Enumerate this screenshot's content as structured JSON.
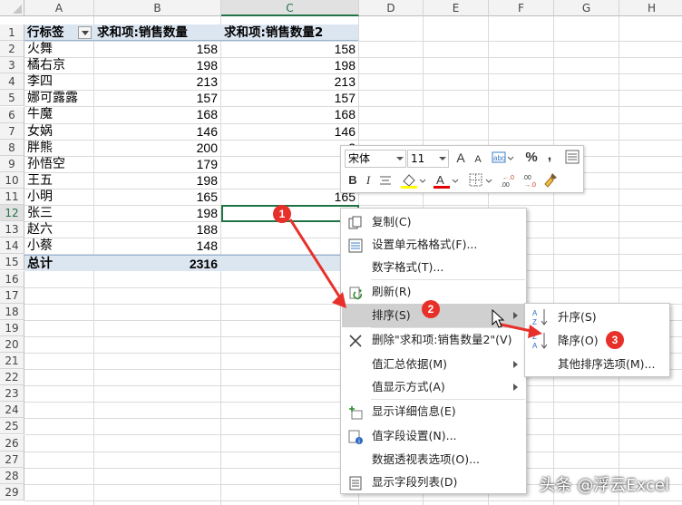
{
  "columns": [
    "A",
    "B",
    "C",
    "D",
    "E",
    "F",
    "G",
    "H"
  ],
  "selected_column": "C",
  "row_numbers": [
    "1",
    "2",
    "3",
    "4",
    "5",
    "6",
    "7",
    "8",
    "9",
    "10",
    "11",
    "12",
    "13",
    "14",
    "15",
    "16",
    "17",
    "18",
    "19",
    "20",
    "21",
    "22",
    "23",
    "24",
    "25",
    "26",
    "27",
    "28",
    "29"
  ],
  "selected_row": "12",
  "pivot": {
    "header": {
      "a": "行标签",
      "b": "求和项:销售数量",
      "c": "求和项:销售数量2"
    },
    "rows": [
      {
        "a": "火舞",
        "b": "158",
        "c": "158"
      },
      {
        "a": "橘右京",
        "b": "198",
        "c": "198"
      },
      {
        "a": "李四",
        "b": "213",
        "c": "213"
      },
      {
        "a": "娜可露露",
        "b": "157",
        "c": "157"
      },
      {
        "a": "牛魔",
        "b": "168",
        "c": "168"
      },
      {
        "a": "女娲",
        "b": "146",
        "c": "146"
      },
      {
        "a": "胖熊",
        "b": "200",
        "c": "2"
      },
      {
        "a": "孙悟空",
        "b": "179",
        "c": "1"
      },
      {
        "a": "王五",
        "b": "198",
        "c": "1"
      },
      {
        "a": "小明",
        "b": "165",
        "c": "165"
      },
      {
        "a": "张三",
        "b": "198",
        "c": "1"
      },
      {
        "a": "赵六",
        "b": "188",
        "c": "1"
      },
      {
        "a": "小蔡",
        "b": "148",
        "c": "1"
      }
    ],
    "total": {
      "a": "总计",
      "b": "2316",
      "c": "23"
    }
  },
  "mini_toolbar": {
    "font_name": "宋体",
    "font_size": "11",
    "increase_font": "A",
    "decrease_font": "A",
    "percent": "%",
    "comma": ",",
    "bold": "B",
    "italic": "I",
    "font_color_letter": "A",
    "dec_increase": "←.0\n.00",
    "dec_decrease": ".00\n→.0",
    "icons": [
      "format-icon",
      "align-icon",
      "fill-color-icon",
      "font-color-icon",
      "borders-icon",
      "format-painter-icon"
    ]
  },
  "context_menu": {
    "items": [
      {
        "label": "复制(C)",
        "icon": "copy-icon"
      },
      {
        "label": "设置单元格格式(F)...",
        "icon": "format-cells-icon"
      },
      {
        "label": "数字格式(T)...",
        "icon": ""
      },
      {
        "label": "刷新(R)",
        "icon": "refresh-icon"
      },
      {
        "label": "排序(S)",
        "icon": "",
        "submenu": true
      },
      {
        "label": "删除\"求和项:销售数量2\"(V)",
        "icon": "delete-x-icon"
      },
      {
        "label": "值汇总依据(M)",
        "icon": "",
        "submenu": true
      },
      {
        "label": "值显示方式(A)",
        "icon": "",
        "submenu": true
      },
      {
        "label": "显示详细信息(E)",
        "icon": "show-details-icon"
      },
      {
        "label": "值字段设置(N)...",
        "icon": "field-settings-icon"
      },
      {
        "label": "数据透视表选项(O)...",
        "icon": ""
      },
      {
        "label": "显示字段列表(D)",
        "icon": "field-list-icon"
      }
    ]
  },
  "sort_submenu": {
    "items": [
      {
        "label": "升序(S)",
        "icon": "sort-ascending-icon"
      },
      {
        "label": "降序(O)",
        "icon": "sort-descending-icon"
      },
      {
        "label": "其他排序选项(M)...",
        "icon": ""
      }
    ]
  },
  "badges": [
    "1",
    "2",
    "3"
  ],
  "watermark": "头条 @浮云Excel",
  "colors": {
    "accent_green": "#217346",
    "pivot_header_bg": "#dce6f1",
    "badge_red": "#e8302a",
    "menu_highlight": "#d0d0d0"
  }
}
